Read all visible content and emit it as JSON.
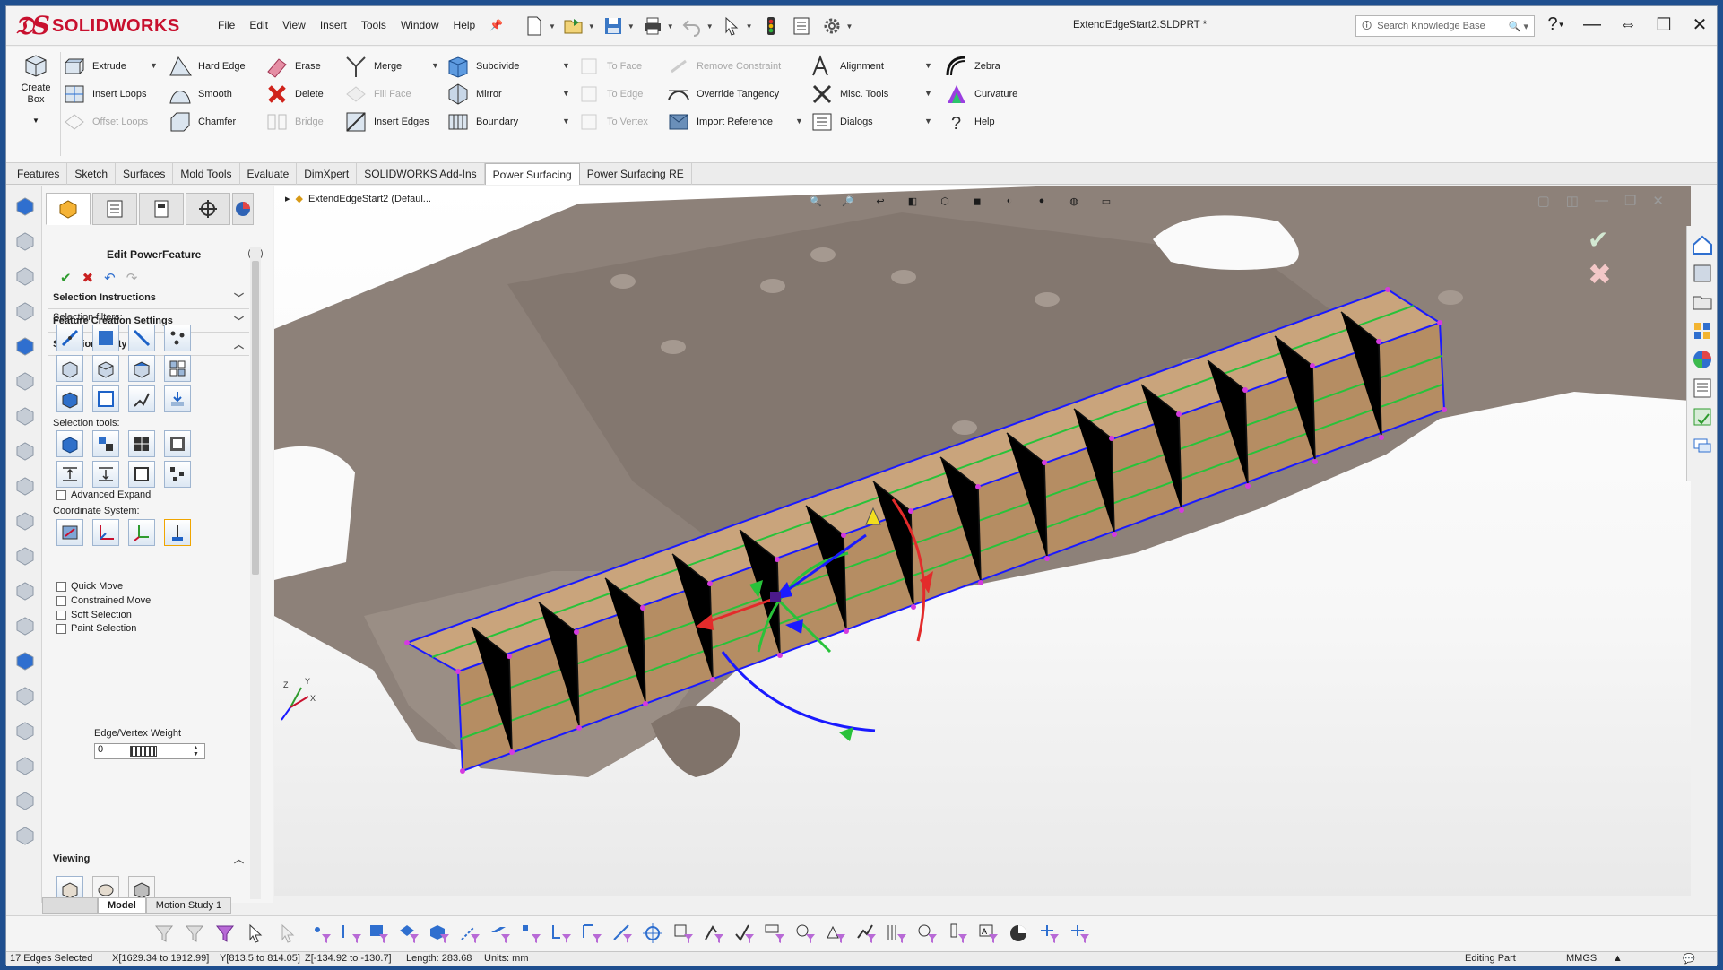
{
  "app": {
    "brand": "SOLIDWORKS",
    "document_title": "ExtendEdgeStart2.SLDPRT *",
    "search_placeholder": "Search Knowledge Base"
  },
  "menu": [
    "File",
    "Edit",
    "View",
    "Insert",
    "Tools",
    "Window",
    "Help"
  ],
  "ribbon": {
    "create_box": "Create Box",
    "col1": [
      "Extrude",
      "Insert Loops",
      "Offset Loops"
    ],
    "col2": [
      "Hard Edge",
      "Smooth",
      "Chamfer"
    ],
    "col3": [
      "Erase",
      "Delete",
      "Bridge"
    ],
    "col4": [
      "Merge",
      "Fill Face",
      "Insert Edges"
    ],
    "col5": [
      "Subdivide",
      "Mirror",
      "Boundary"
    ],
    "col6": [
      "To Face",
      "To Edge",
      "To Vertex"
    ],
    "col7": [
      "Remove Constraint",
      "Override Tangency",
      "Import Reference"
    ],
    "col8": [
      "Alignment",
      "Misc. Tools",
      "Dialogs"
    ],
    "col9": [
      "Zebra",
      "Curvature",
      "Help"
    ]
  },
  "tabs": [
    "Features",
    "Sketch",
    "Surfaces",
    "Mold Tools",
    "Evaluate",
    "DimXpert",
    "SOLIDWORKS Add-Ins",
    "Power Surfacing",
    "Power Surfacing RE"
  ],
  "active_tab": "Power Surfacing",
  "property_manager": {
    "title": "Edit PowerFeature",
    "help": "?",
    "groups": {
      "selection_instructions": "Selection Instructions",
      "feature_creation": "Feature Creation Settings",
      "selection_utility": "Selection Utility",
      "viewing": "Viewing"
    },
    "selection_filters_label": "Selection filters:",
    "selection_tools_label": "Selection tools:",
    "advanced_expand": "Advanced Expand",
    "coordinate_system_label": "Coordinate System:",
    "edge_vertex_weight_label": "Edge/Vertex Weight",
    "edge_vertex_weight_value": "0",
    "options": [
      "Quick Move",
      "Constrained Move",
      "Soft Selection",
      "Paint Selection"
    ]
  },
  "feature_tree": {
    "root": "ExtendEdgeStart2  (Defaul..."
  },
  "bottom_tabs": [
    "Model",
    "Motion Study 1"
  ],
  "status": {
    "selection": "17 Edges Selected",
    "x": "X[1629.34 to 1912.99]",
    "y": "Y[813.5 to 814.05]",
    "z": "Z[-134.92 to -130.7]",
    "length": "Length: 283.68",
    "units": "Units: mm",
    "mode": "Editing Part",
    "unit_system": "MMGS"
  },
  "colors": {
    "accent_red": "#c8102e",
    "mesh_blue": "#1a1aff",
    "mesh_green": "#29c23a",
    "vertex_magenta": "#d43adf",
    "face_tan": "#c9a47c",
    "part_grey": "#8d8179"
  }
}
